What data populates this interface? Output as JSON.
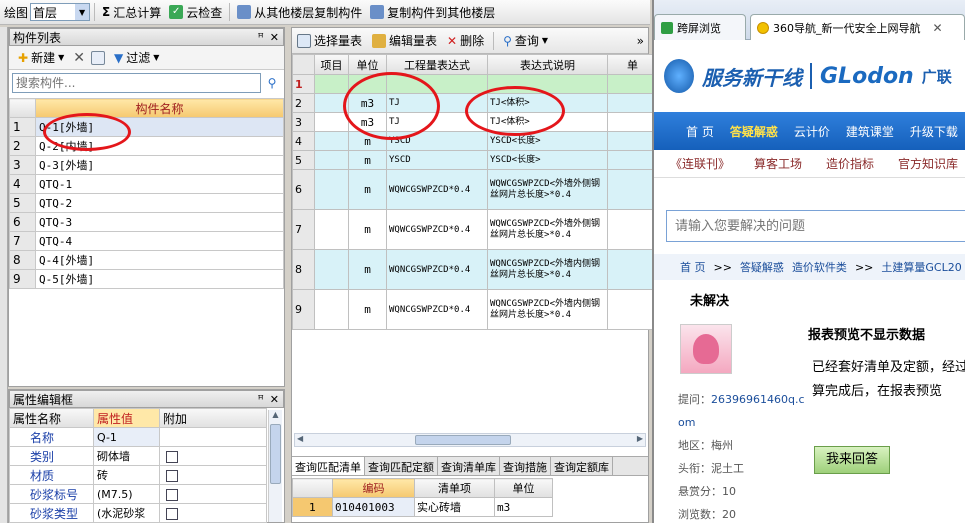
{
  "toolbar": {
    "draw": "绘图",
    "floor": "首层",
    "summarize": "汇总计算",
    "cloud_check": "云检查",
    "copy_from": "从其他楼层复制构件",
    "copy_to": "复制构件到其他楼层"
  },
  "left": {
    "title": "构件列表",
    "new": "新建",
    "filter": "过滤",
    "search_placeholder": "搜索构件...",
    "col_name": "构件名称",
    "rows": [
      {
        "n": "1",
        "v": "Q-1[外墙]"
      },
      {
        "n": "2",
        "v": "Q-2[内墙]"
      },
      {
        "n": "3",
        "v": "Q-3[外墙]"
      },
      {
        "n": "4",
        "v": "QTQ-1"
      },
      {
        "n": "5",
        "v": "QTQ-2"
      },
      {
        "n": "6",
        "v": "QTQ-3"
      },
      {
        "n": "7",
        "v": "QTQ-4"
      },
      {
        "n": "8",
        "v": "Q-4[外墙]"
      },
      {
        "n": "9",
        "v": "Q-5[外墙]"
      }
    ]
  },
  "props": {
    "title": "属性编辑框",
    "col_name": "属性名称",
    "col_value": "属性值",
    "col_extra": "附加",
    "rows": [
      {
        "k": "名称",
        "v": "Q-1"
      },
      {
        "k": "类别",
        "v": "砌体墙"
      },
      {
        "k": "材质",
        "v": "砖"
      },
      {
        "k": "砂浆标号",
        "v": "(M7.5)"
      },
      {
        "k": "砂浆类型",
        "v": "(水泥砂浆"
      }
    ]
  },
  "center": {
    "select_table": "选择量表",
    "edit_table": "编辑量表",
    "delete": "删除",
    "query": "查询",
    "cols": [
      "项目",
      "单位",
      "工程量表达式",
      "表达式说明",
      "单"
    ],
    "rows": [
      {
        "n": "1",
        "u": "",
        "e": "",
        "d": ""
      },
      {
        "n": "2",
        "u": "m3",
        "e": "TJ",
        "d": "TJ<体积>"
      },
      {
        "n": "3",
        "u": "m3",
        "e": "TJ",
        "d": "TJ<体积>"
      },
      {
        "n": "4",
        "u": "m",
        "e": "YSCD",
        "d": "YSCD<长度>"
      },
      {
        "n": "5",
        "u": "m",
        "e": "YSCD",
        "d": "YSCD<长度>"
      },
      {
        "n": "6",
        "u": "m",
        "e": "WQWCGSWPZCD*0.4",
        "d": "WQWCGSWPZCD<外墙外侧钢丝网片总长度>*0.4"
      },
      {
        "n": "7",
        "u": "m",
        "e": "WQWCGSWPZCD*0.4",
        "d": "WQWCGSWPZCD<外墙外侧钢丝网片总长度>*0.4"
      },
      {
        "n": "8",
        "u": "m",
        "e": "WQNCGSWPZCD*0.4",
        "d": "WQNCGSWPZCD<外墙内侧钢丝网片总长度>*0.4"
      },
      {
        "n": "9",
        "u": "m",
        "e": "WQNCGSWPZCD*0.4",
        "d": "WQNCGSWPZCD<外墙内侧钢丝网片总长度>*0.4"
      }
    ],
    "bottom_tabs": [
      "查询匹配清单",
      "查询匹配定额",
      "查询清单库",
      "查询措施",
      "查询定额库"
    ],
    "bottom_cols": [
      "编码",
      "清单项",
      "单位"
    ],
    "bottom_rows": [
      {
        "n": "1",
        "code": "010401003",
        "item": "实心砖墙",
        "unit": "m3"
      }
    ]
  },
  "browser": {
    "tab1": "跨屏浏览",
    "tab2": "360导航_新一代安全上网导航",
    "logo_cn": "服务新干线",
    "logo_en": "GLodon",
    "logo_tail": "广联",
    "nav": [
      "首 页",
      "答疑解惑",
      "云计价",
      "建筑课堂",
      "升级下载"
    ],
    "subnav": [
      "《连联刊》",
      "算客工场",
      "造价指标",
      "官方知识库"
    ],
    "search_placeholder": "请输入您要解决的问题",
    "crumbs": [
      "首 页",
      ">>",
      "答疑解惑",
      "造价软件类",
      ">>",
      "土建算量GCL20"
    ],
    "status": "未解决",
    "question_title": "报表预览不显示数据",
    "question_text": "已经套好清单及定额，经过汇总计算完成后，在报表预览",
    "asker_label": "提问：",
    "asker": "26396961460q.com",
    "region_label": "地区：",
    "region": "梅州",
    "rank_label": "头衔：",
    "rank": "泥土工",
    "reward_label": "悬赏分：",
    "reward": "10",
    "views_label": "浏览数：",
    "views": "20",
    "answer_btn": "我来回答"
  }
}
